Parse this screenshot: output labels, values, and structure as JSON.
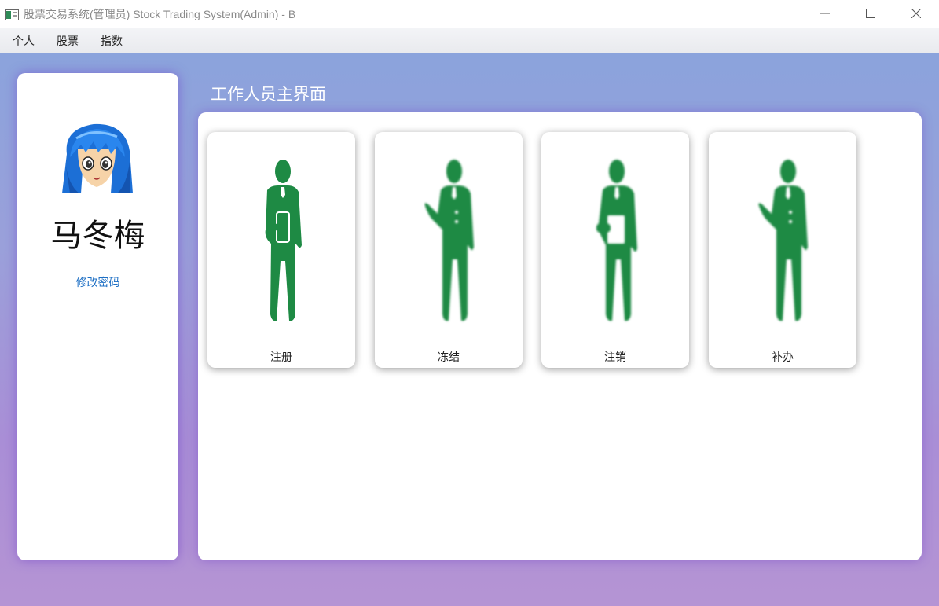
{
  "window": {
    "title": "股票交易系统(管理员) Stock Trading System(Admin) - B",
    "controls": [
      "minimize-icon",
      "maximize-icon",
      "close-icon"
    ]
  },
  "menu": {
    "items": [
      {
        "label": "个人"
      },
      {
        "label": "股票"
      },
      {
        "label": "指数"
      }
    ]
  },
  "profile": {
    "name": "马冬梅",
    "change_password": "修改密码",
    "avatar_icon": "anime-avatar-icon"
  },
  "main": {
    "title": "工作人员主界面",
    "tiles": [
      {
        "label": "注册",
        "icon": "staff-with-phone-icon"
      },
      {
        "label": "冻结",
        "icon": "staff-waving-icon"
      },
      {
        "label": "注销",
        "icon": "staff-with-clipboard-icon"
      },
      {
        "label": "补办",
        "icon": "staff-waving-icon"
      }
    ]
  },
  "colors": {
    "accent_green": "#1e8a44",
    "link_blue": "#1d6fc4",
    "bg_top": "#8ba3dc",
    "bg_bottom": "#b594d4"
  }
}
